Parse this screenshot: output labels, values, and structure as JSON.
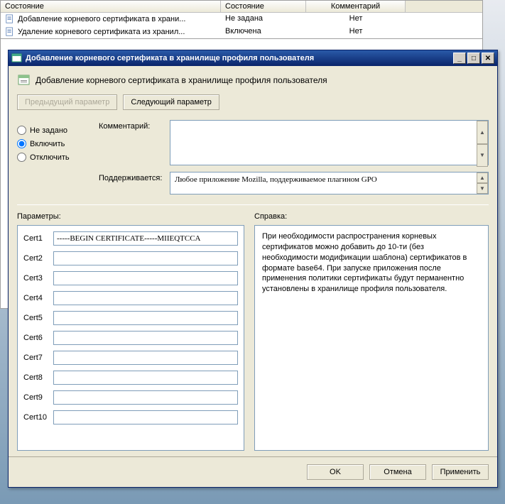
{
  "bg_table": {
    "headers": [
      "Состояние",
      "Состояние",
      "Комментарий"
    ],
    "rows": [
      {
        "name": "Добавление корневого сертификата в храни...",
        "state": "Не задана",
        "comment": "Нет"
      },
      {
        "name": "Удаление корневого сертификата из хранил...",
        "state": "Включена",
        "comment": "Нет"
      }
    ]
  },
  "dialog": {
    "title": "Добавление корневого сертификата в хранилище профиля пользователя",
    "heading": "Добавление корневого сертификата в хранилище профиля пользователя",
    "nav": {
      "prev": "Предыдущий параметр",
      "next": "Следующий параметр"
    },
    "radios": {
      "not_set": "Не задано",
      "enable": "Включить",
      "disable": "Отключить"
    },
    "comment_label": "Комментарий:",
    "comment_value": "",
    "supported_label": "Поддерживается:",
    "supported_value": "Любое приложение Mozilla, поддерживаемое плагином GPO",
    "params_label": "Параметры:",
    "help_label": "Справка:",
    "certs": [
      {
        "label": "Cert1",
        "value": "-----BEGIN CERTIFICATE-----MIIEQTCCA"
      },
      {
        "label": "Cert2",
        "value": ""
      },
      {
        "label": "Cert3",
        "value": ""
      },
      {
        "label": "Cert4",
        "value": ""
      },
      {
        "label": "Cert5",
        "value": ""
      },
      {
        "label": "Cert6",
        "value": ""
      },
      {
        "label": "Cert7",
        "value": ""
      },
      {
        "label": "Cert8",
        "value": ""
      },
      {
        "label": "Cert9",
        "value": ""
      },
      {
        "label": "Cert10",
        "value": ""
      }
    ],
    "help_text": "При необходимости распространения корневых сертификатов можно добавить до 10-ти (без необходимости модификации шаблона) сертификатов в формате base64. При запуске приложения после применения политики сертификаты будут перманентно установлены в хранилище профиля пользователя.",
    "buttons": {
      "ok": "OK",
      "cancel": "Отмена",
      "apply": "Применить"
    }
  }
}
